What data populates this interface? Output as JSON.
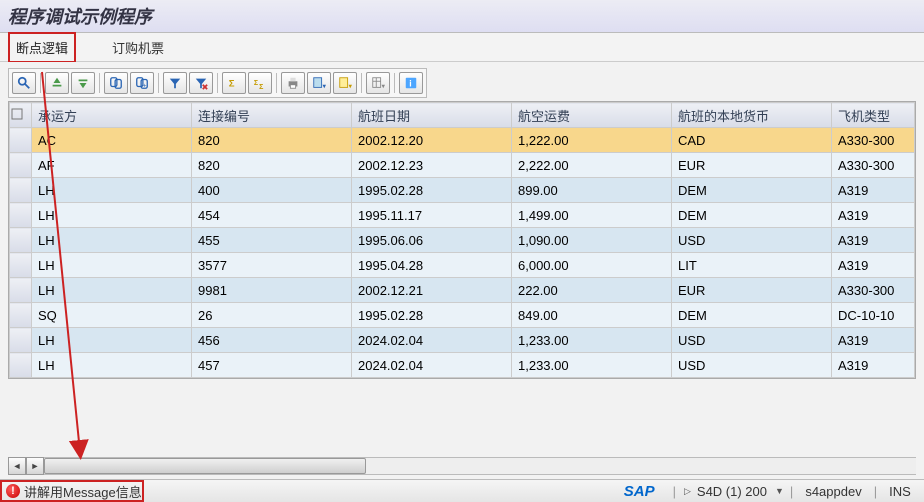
{
  "header": {
    "title": "程序调试示例程序"
  },
  "tabs": {
    "breakpoint": "断点逻辑",
    "book": "订购机票"
  },
  "icons": {
    "refresh": "refresh",
    "up": "up",
    "down": "down",
    "find": "find",
    "findnext": "findnext",
    "filter": "filter",
    "filter2": "filter2",
    "sum": "sum",
    "sum2": "sum2",
    "print": "print",
    "view": "view",
    "export": "export",
    "layout": "layout",
    "info": "info"
  },
  "columns": {
    "sel": "",
    "carr": "承运方",
    "conn": "连接编号",
    "fldate": "航班日期",
    "price": "航空运费",
    "curr": "航班的本地货币",
    "ptype": "飞机类型"
  },
  "rows": [
    {
      "carr": "AC",
      "conn": "820",
      "fldate": "2002.12.20",
      "price": "1,222.00",
      "curr": "CAD",
      "ptype": "A330-300",
      "sel": true
    },
    {
      "carr": "AF",
      "conn": "820",
      "fldate": "2002.12.23",
      "price": "2,222.00",
      "curr": "EUR",
      "ptype": "A330-300"
    },
    {
      "carr": "LH",
      "conn": "400",
      "fldate": "1995.02.28",
      "price": "899.00",
      "curr": "DEM",
      "ptype": "A319"
    },
    {
      "carr": "LH",
      "conn": "454",
      "fldate": "1995.11.17",
      "price": "1,499.00",
      "curr": "DEM",
      "ptype": "A319"
    },
    {
      "carr": "LH",
      "conn": "455",
      "fldate": "1995.06.06",
      "price": "1,090.00",
      "curr": "USD",
      "ptype": "A319"
    },
    {
      "carr": "LH",
      "conn": "3577",
      "fldate": "1995.04.28",
      "price": "6,000.00",
      "curr": "LIT",
      "ptype": "A319"
    },
    {
      "carr": "LH",
      "conn": "9981",
      "fldate": "2002.12.21",
      "price": "222.00",
      "curr": "EUR",
      "ptype": "A330-300"
    },
    {
      "carr": "SQ",
      "conn": "26",
      "fldate": "1995.02.28",
      "price": "849.00",
      "curr": "DEM",
      "ptype": "DC-10-10"
    },
    {
      "carr": "LH",
      "conn": "456",
      "fldate": "2024.02.04",
      "price": "1,233.00",
      "curr": "USD",
      "ptype": "A319"
    },
    {
      "carr": "LH",
      "conn": "457",
      "fldate": "2024.02.04",
      "price": "1,233.00",
      "curr": "USD",
      "ptype": "A319"
    }
  ],
  "status": {
    "message": "讲解用Message信息",
    "system": "S4D (1) 200",
    "server": "s4appdev",
    "mode": "INS"
  }
}
